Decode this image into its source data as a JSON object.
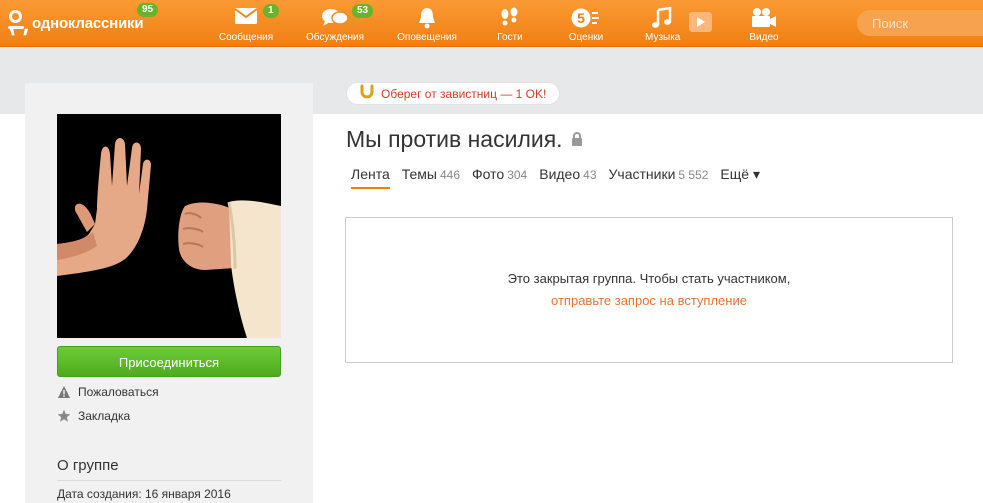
{
  "header": {
    "logo_text": "одноклассники",
    "logo_badge": "95",
    "search_placeholder": "Поиск",
    "nav": [
      {
        "label": "Сообщения",
        "badge": "1"
      },
      {
        "label": "Обсуждения",
        "badge": "53"
      },
      {
        "label": "Оповещения",
        "badge": ""
      },
      {
        "label": "Гости",
        "badge": ""
      },
      {
        "label": "Оценки",
        "badge": ""
      },
      {
        "label": "Музыка",
        "badge": ""
      },
      {
        "label": "Видео",
        "badge": ""
      }
    ],
    "ratings_icon_digit": "5"
  },
  "promo": {
    "text": "Оберег от завистниц — 1 OK!"
  },
  "group": {
    "title": "Мы против насилия.",
    "tabs": [
      {
        "label": "Лента",
        "count": ""
      },
      {
        "label": "Темы",
        "count": "446"
      },
      {
        "label": "Фото",
        "count": "304"
      },
      {
        "label": "Видео",
        "count": "43"
      },
      {
        "label": "Участники",
        "count": "5 552"
      },
      {
        "label": "Ещё ▾",
        "count": ""
      }
    ],
    "closed_text": "Это закрытая группа. Чтобы стать участником,",
    "closed_link": "отправьте запрос на вступление"
  },
  "sidebar": {
    "join_label": "Присоединиться",
    "report_label": "Пожаловаться",
    "bookmark_label": "Закладка",
    "about_title": "О группе",
    "created": "Дата создания: 16 января 2016"
  },
  "colors": {
    "brand_orange": "#f07f12",
    "badge_green": "#69b32a",
    "join_green": "#4fab1e",
    "link_orange": "#eb722e",
    "promo_red": "#d83a25"
  }
}
